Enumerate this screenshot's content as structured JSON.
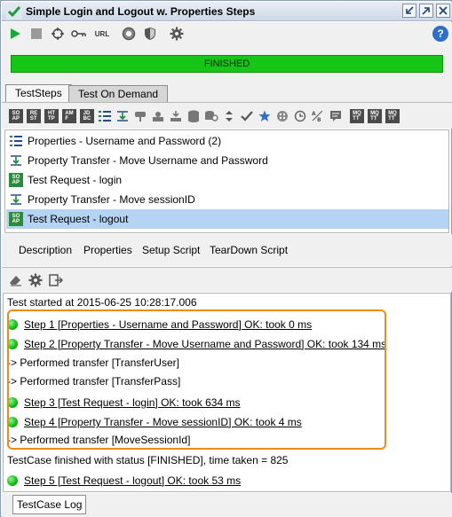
{
  "window": {
    "title": "Simple Login and Logout w. Properties Steps"
  },
  "toolbar": {
    "run_icon": "play-icon",
    "stop_icon": "stop-icon",
    "options_icon": "target-icon",
    "credentials_icon": "key-icon",
    "url_label": "URL",
    "coverage_icon": "coverage-icon",
    "security_icon": "shield-icon",
    "settings_icon": "gear-icon",
    "help_label": "?"
  },
  "status": {
    "label": "FINISHED",
    "progress_percent": 100,
    "color": "#16c516"
  },
  "tabs": [
    {
      "label": "TestSteps",
      "active": true
    },
    {
      "label": "Test On Demand",
      "active": false
    }
  ],
  "steps": [
    {
      "label": "Properties - Username and Password (2)",
      "icon": "properties-icon"
    },
    {
      "label": "Property Transfer - Move Username and Password",
      "icon": "property-transfer-icon"
    },
    {
      "label": "Test Request - login",
      "icon": "soap-request-icon"
    },
    {
      "label": "Property Transfer - Move sessionID",
      "icon": "property-transfer-icon"
    },
    {
      "label": "Test Request - logout",
      "icon": "soap-request-icon",
      "selected": true
    }
  ],
  "subtabs": [
    "Description",
    "Properties",
    "Setup Script",
    "TearDown Script"
  ],
  "log": {
    "header": "Test started at 2015-06-25 10:28:17.006",
    "entries": [
      {
        "type": "step",
        "text": "Step 1 [Properties - Username and Password] OK: took 0 ms"
      },
      {
        "type": "step",
        "text": "Step 2 [Property Transfer - Move Username and Password] OK: took 134 ms"
      },
      {
        "type": "info",
        "text": "-> Performed transfer [TransferUser]"
      },
      {
        "type": "info",
        "text": "-> Performed transfer [TransferPass]"
      },
      {
        "type": "step",
        "text": "Step 3 [Test Request - login] OK: took 634 ms"
      },
      {
        "type": "step",
        "text": "Step 4 [Property Transfer - Move sessionID] OK: took 4 ms"
      },
      {
        "type": "info",
        "text": "-> Performed transfer [MoveSessionId]"
      }
    ],
    "finished": "TestCase finished with status [FINISHED], time taken = 825",
    "last_step": "Step 5 [Test Request - logout] OK: took 53 ms",
    "highlight_color": "#f08a1e"
  },
  "bottom_tab": "TestCase Log"
}
